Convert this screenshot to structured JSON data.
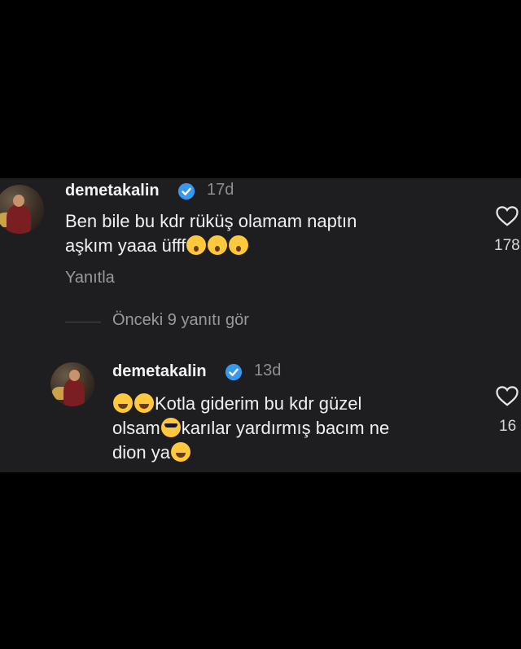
{
  "comment": {
    "username": "demetakalin",
    "time": "17d",
    "line1": "Ben bile bu kdr rüküş olamam naptın",
    "line2": "aşkım yaaa üfff",
    "emojis": [
      "astonished-emoji",
      "astonished-emoji",
      "astonished-emoji"
    ],
    "reply_label": "Yanıtla",
    "likes": "178"
  },
  "view_previous": "Önceki 9 yanıtı gör",
  "reply": {
    "username": "demetakalin",
    "time": "13d",
    "line1": "Kotla giderim bu kdr güzel",
    "line2a": "olsam",
    "line2b": "karılar yardırmış bacım ne",
    "line3": "dion ya",
    "emojis": [
      "laughing-emoji",
      "laughing-emoji",
      "sunglasses-emoji",
      "laughing-emoji"
    ],
    "likes": "16"
  },
  "colors": {
    "background": "#000000",
    "panel": "#1e1e21",
    "verified": "#3897f0"
  }
}
